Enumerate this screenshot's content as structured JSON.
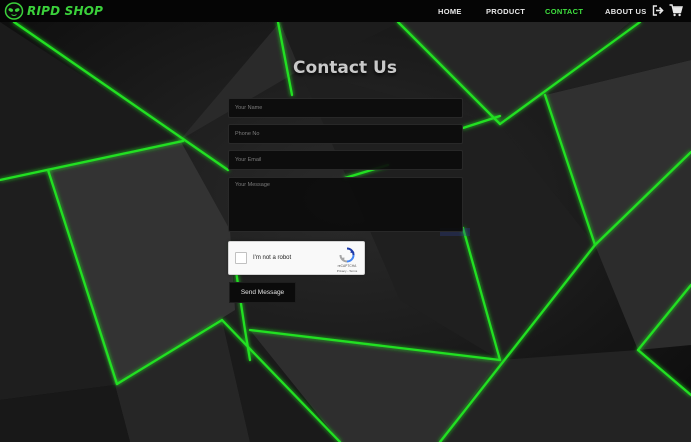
{
  "brand": {
    "name": "RIPD SHOP",
    "accent": "#3fe03f"
  },
  "nav": {
    "items": [
      {
        "label": "HOME",
        "active": false
      },
      {
        "label": "PRODUCT",
        "active": false
      },
      {
        "label": "CONTACT",
        "active": true
      },
      {
        "label": "ABOUT US",
        "active": false
      }
    ],
    "icons": [
      "logout-icon",
      "cart-icon"
    ]
  },
  "page": {
    "title": "Contact Us"
  },
  "form": {
    "name_placeholder": "Your Name",
    "phone_placeholder": "Phone No",
    "email_placeholder": "Your Email",
    "message_placeholder": "Your Message",
    "captcha": {
      "label": "I'm not a robot",
      "brand": "reCAPTCHA",
      "links": "Privacy - Terms"
    },
    "submit_label": "Send Message"
  },
  "colors": {
    "nav_bg": "#050505",
    "neon_green": "#22e022",
    "field_bg": "#0c0c0c"
  }
}
